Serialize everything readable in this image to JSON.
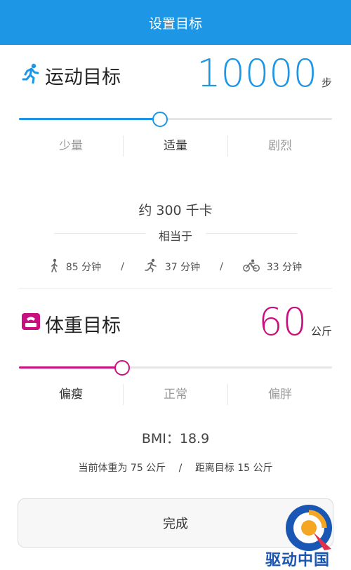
{
  "header": {
    "title": "设置目标"
  },
  "exercise": {
    "title": "运动目标",
    "value": "10000",
    "unit": "步",
    "accent": "#1e96e6",
    "slider_fraction": 0.45,
    "levels": [
      "少量",
      "适量",
      "剧烈"
    ],
    "active_level": 1,
    "calories": "约 300 千卡",
    "equivalent_label": "相当于",
    "activities": [
      {
        "icon": "walking-icon",
        "text": "85 分钟"
      },
      {
        "icon": "running-icon",
        "text": "37 分钟"
      },
      {
        "icon": "cycling-icon",
        "text": "33 分钟"
      }
    ],
    "separator": "/"
  },
  "weight": {
    "title": "体重目标",
    "value": "60",
    "unit": "公斤",
    "accent": "#c8107e",
    "slider_fraction": 0.33,
    "levels": [
      "偏瘦",
      "正常",
      "偏胖"
    ],
    "active_level": 0,
    "bmi": "BMI：18.9",
    "current_weight": "当前体重为 75 公斤",
    "distance": "距离目标 15 公斤",
    "separator": "/"
  },
  "done_button": {
    "label": "完成"
  },
  "watermark": {
    "text": "驱动中国"
  }
}
